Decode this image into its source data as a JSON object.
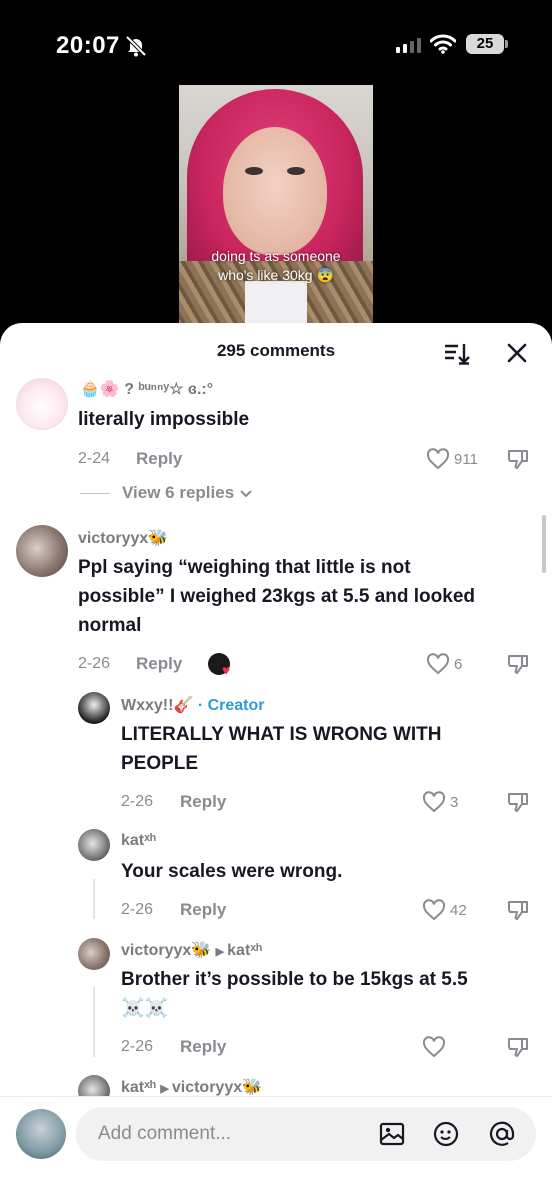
{
  "status": {
    "time": "20:07",
    "battery": "25"
  },
  "video": {
    "caption_line1": "doing ts as someone",
    "caption_line2": "who's like 30kg 😨"
  },
  "comments_header": {
    "count_label": "295 comments"
  },
  "comments": [
    {
      "username": "🧁🌸 ? ᵇᵘⁿⁿʸ☆ ɞ.:°",
      "text": "literally impossible",
      "date": "2-24",
      "reply_label": "Reply",
      "likes": "911",
      "view_replies": "View 6 replies"
    },
    {
      "username": "victoryyx🐝",
      "text_lines": [
        "Ppl saying “weighing that little is not",
        "possible” I weighed 23kgs at 5.5 and looked",
        "normal"
      ],
      "date": "2-26",
      "reply_label": "Reply",
      "likes": "6"
    },
    {
      "username": "Wxxy!!🎸",
      "badge": "· Creator",
      "text_lines": [
        "LITERALLY WHAT IS WRONG WITH",
        "PEOPLE"
      ],
      "date": "2-26",
      "reply_label": "Reply",
      "likes": "3"
    },
    {
      "username": "katˣʰ",
      "text": "Your scales were wrong.",
      "date": "2-26",
      "reply_label": "Reply",
      "likes": "42"
    },
    {
      "username": "victoryyx🐝",
      "reply_to": "katˣʰ",
      "text_lines": [
        "Brother it’s possible to be 15kgs at 5.5",
        "☠️☠️"
      ],
      "date": "2-26",
      "reply_label": "Reply",
      "likes": ""
    },
    {
      "username": "katˣʰ",
      "reply_to": "victoryyx🐝"
    }
  ],
  "input": {
    "placeholder": "Add comment..."
  },
  "colors": {
    "creator": "#2f9bd6",
    "muted": "#8a8b91",
    "text": "#161823"
  }
}
